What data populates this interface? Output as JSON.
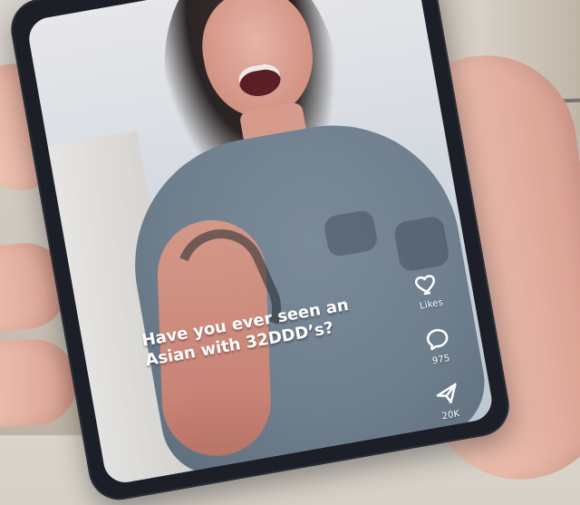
{
  "scene": {
    "caption": "Have you ever seen an Asian with 32DDD’s?",
    "actions": {
      "likes_label": "Likes",
      "comment_count": "975",
      "share_count": "20K"
    }
  },
  "colors": {
    "caption_text": "#ffffff",
    "ui_text": "#ffffff"
  }
}
